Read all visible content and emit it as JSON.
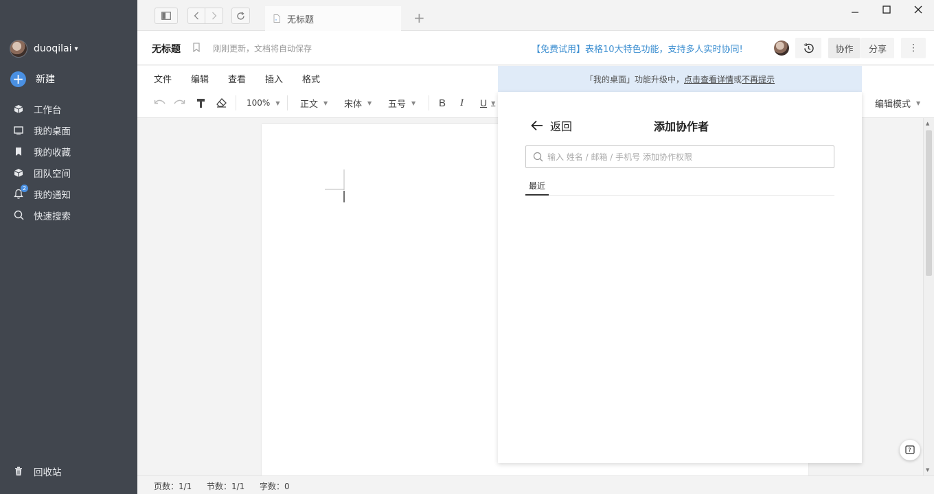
{
  "sidebar": {
    "username": "duoqilai",
    "new_label": "新建",
    "items": [
      {
        "label": "工作台",
        "icon": "cube-icon"
      },
      {
        "label": "我的桌面",
        "icon": "desktop-icon"
      },
      {
        "label": "我的收藏",
        "icon": "bookmark-icon"
      },
      {
        "label": "团队空间",
        "icon": "box-icon"
      },
      {
        "label": "我的通知",
        "icon": "bell-icon",
        "badge": "2"
      },
      {
        "label": "快速搜索",
        "icon": "search-icon"
      }
    ],
    "trash_label": "回收站"
  },
  "tab": {
    "label": "无标题"
  },
  "doc": {
    "title": "无标题",
    "save_status": "刚刚更新，文档将自动保存",
    "promo": "【免费试用】表格10大特色功能，支持多人实时协同!",
    "collab_label": "协作",
    "share_label": "分享"
  },
  "menu": [
    "文件",
    "编辑",
    "查看",
    "插入",
    "格式"
  ],
  "toolbar": {
    "zoom": "100%",
    "style": "正文",
    "font": "宋体",
    "size": "五号",
    "bold": "B",
    "italic": "I",
    "underline": "U",
    "mode": "编辑模式"
  },
  "status": {
    "pages": "页数：1/1",
    "sections": "节数：1/1",
    "words": "字数：0"
  },
  "panel": {
    "banner_prefix": "「我的桌面」功能升级中，",
    "banner_link1": "点击查看详情",
    "banner_or": "或",
    "banner_link2": "不再提示",
    "back_label": "返回",
    "title": "添加协作者",
    "search_placeholder": "输入 姓名 / 邮箱 / 手机号 添加协作权限",
    "recent_tab": "最近"
  },
  "colors": {
    "accent": "#4a90e2",
    "sidebar_bg": "#41464e",
    "promo": "#3d8fd1",
    "banner_bg": "#e0ebf8"
  }
}
